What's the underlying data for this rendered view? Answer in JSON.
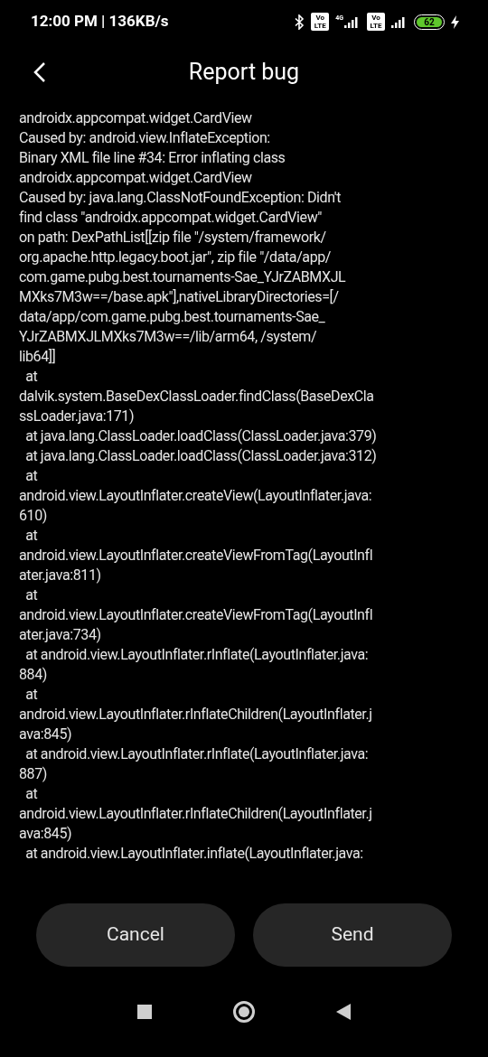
{
  "status_bar": {
    "time": "12:00 PM | 136KB/s",
    "sim_1": {
      "badge_top": "Vo",
      "badge_bottom": "LTE",
      "network": "4G"
    },
    "sim_2": {
      "badge_top": "Vo",
      "badge_bottom": "LTE"
    },
    "battery": "62",
    "charging": true
  },
  "header": {
    "title": "Report bug"
  },
  "log_lines": [
    "androidx.appcompat.widget.CardView",
    "Caused by: android.view.InflateException:",
    "Binary XML file line #34: Error inflating class",
    "androidx.appcompat.widget.CardView",
    "Caused by: java.lang.ClassNotFoundException: Didn't",
    "find class \"androidx.appcompat.widget.CardView\"",
    "on path: DexPathList[[zip file \"/system/framework/",
    "org.apache.http.legacy.boot.jar\", zip file \"/data/app/",
    "com.game.pubg.best.tournaments-Sae_YJrZABMXJL",
    "MXks7M3w==/base.apk\"],nativeLibraryDirectories=[/",
    "data/app/com.game.pubg.best.tournaments-Sae_",
    "YJrZABMXJLMXks7M3w==/lib/arm64, /system/",
    "lib64]]",
    "  at",
    "dalvik.system.BaseDexClassLoader.findClass(BaseDexCla",
    "ssLoader.java:171)",
    "  at java.lang.ClassLoader.loadClass(ClassLoader.java:379)",
    "  at java.lang.ClassLoader.loadClass(ClassLoader.java:312)",
    "  at",
    "android.view.LayoutInflater.createView(LayoutInflater.java:",
    "610)",
    "  at",
    "android.view.LayoutInflater.createViewFromTag(LayoutInfl",
    "ater.java:811)",
    "  at",
    "android.view.LayoutInflater.createViewFromTag(LayoutInfl",
    "ater.java:734)",
    "  at android.view.LayoutInflater.rInflate(LayoutInflater.java:",
    "884)",
    "  at",
    "android.view.LayoutInflater.rInflateChildren(LayoutInflater.j",
    "ava:845)",
    "  at android.view.LayoutInflater.rInflate(LayoutInflater.java:",
    "887)",
    "  at",
    "android.view.LayoutInflater.rInflateChildren(LayoutInflater.j",
    "ava:845)",
    "  at android.view.LayoutInflater.inflate(LayoutInflater.java:"
  ],
  "buttons": [
    "Cancel",
    "Send"
  ]
}
